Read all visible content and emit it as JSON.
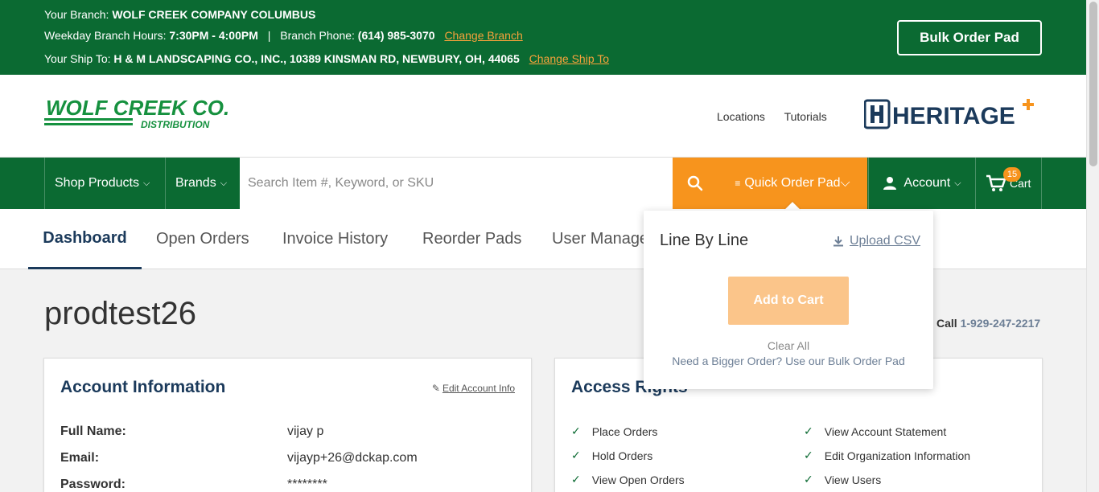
{
  "topbar": {
    "branch_label": "Your Branch:",
    "branch_name": "WOLF CREEK COMPANY COLUMBUS",
    "hours_label": "Weekday Branch Hours:",
    "hours_value": "7:30PM - 4:00PM",
    "separator": "|",
    "phone_label": "Branch Phone:",
    "phone_value": "(614) 985-3070",
    "change_branch": "Change Branch",
    "ship_label": "Your Ship To:",
    "ship_value": "H & M LANDSCAPING CO., INC., 10389 KINSMAN RD, NEWBURY, OH, 44065",
    "change_ship": "Change Ship To",
    "bulk_order_pad": "Bulk Order Pad"
  },
  "header": {
    "logo_main": "WOLF CREEK CO.",
    "logo_sub": "DISTRIBUTION",
    "links": [
      "Locations",
      "Tutorials"
    ],
    "partner_logo": "HERITAGE"
  },
  "nav": {
    "shop_products": "Shop Products",
    "brands": "Brands",
    "search_placeholder": "Search Item #, Keyword, or SKU",
    "quick_order_pad": "Quick Order Pad",
    "account": "Account",
    "cart": "Cart",
    "cart_count": "15"
  },
  "tabs": [
    "Dashboard",
    "Open Orders",
    "Invoice History",
    "Reorder Pads",
    "User Manage"
  ],
  "page": {
    "username": "prodtest26",
    "call_label": "Call",
    "call_phone": "1-929-247-2217"
  },
  "account_info": {
    "title": "Account Information",
    "edit_link": "Edit Account Info",
    "fields": [
      {
        "label": "Full Name:",
        "value": "vijay p"
      },
      {
        "label": "Email:",
        "value": "vijayp+26@dckap.com"
      },
      {
        "label": "Password:",
        "value": "********"
      }
    ]
  },
  "access_rights": {
    "title": "Access Rights",
    "left": [
      "Place Orders",
      "Hold Orders",
      "View Open Orders"
    ],
    "right": [
      "View Account Statement",
      "Edit Organization Information",
      "View Users"
    ]
  },
  "quick_order_panel": {
    "mode_label": "Line By Line",
    "upload_csv": "Upload CSV",
    "add_to_cart": "Add to Cart",
    "clear_all": "Clear All",
    "bigger_order": "Need a Bigger Order? Use our Bulk Order Pad"
  },
  "colors": {
    "brand_green": "#0b6a32",
    "accent_orange": "#f7941d",
    "navy": "#1b3a5b"
  }
}
